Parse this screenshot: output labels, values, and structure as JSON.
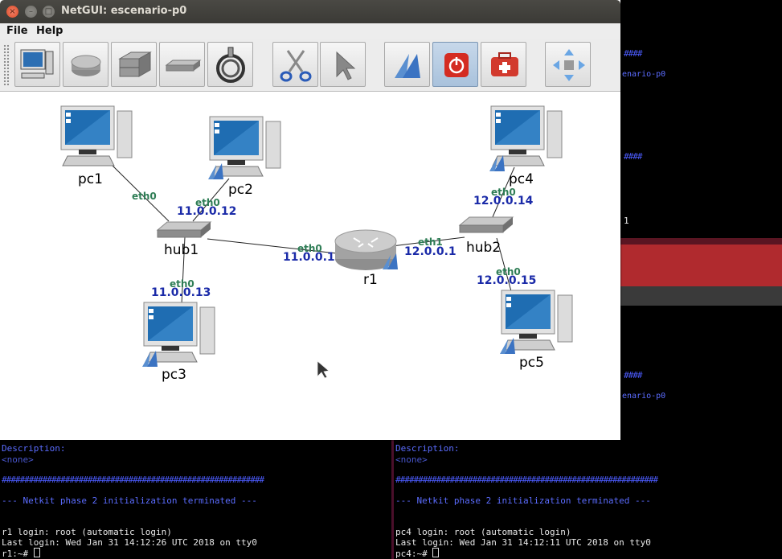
{
  "window": {
    "title": "NetGUI: escenario-p0",
    "controls": {
      "close": "×",
      "minimize": "–",
      "maximize": "□"
    }
  },
  "menubar": {
    "items": [
      {
        "label": "File"
      },
      {
        "label": "Help"
      }
    ]
  },
  "toolbar": {
    "tools": [
      {
        "name": "add-terminal-tool",
        "icon": "pc-icon"
      },
      {
        "name": "add-router-tool",
        "icon": "router-icon"
      },
      {
        "name": "add-switch-tool",
        "icon": "switch-icon"
      },
      {
        "name": "add-hub-tool",
        "icon": "hub-icon"
      },
      {
        "name": "add-link-tool",
        "icon": "cable-icon"
      },
      {
        "name": "delete-tool",
        "icon": "scissors-icon"
      },
      {
        "name": "select-tool",
        "icon": "pointer-icon"
      },
      {
        "name": "start-tool",
        "icon": "start-icon"
      },
      {
        "name": "power-tool",
        "icon": "power-icon",
        "active": true
      },
      {
        "name": "toolbox-tool",
        "icon": "toolbox-icon"
      },
      {
        "name": "move-tool",
        "icon": "move-arrows-icon"
      }
    ]
  },
  "network": {
    "nodes": [
      {
        "id": "pc1",
        "label": "pc1",
        "type": "pc"
      },
      {
        "id": "pc2",
        "label": "pc2",
        "type": "pc"
      },
      {
        "id": "pc3",
        "label": "pc3",
        "type": "pc"
      },
      {
        "id": "pc4",
        "label": "pc4",
        "type": "pc"
      },
      {
        "id": "pc5",
        "label": "pc5",
        "type": "pc"
      },
      {
        "id": "hub1",
        "label": "hub1",
        "type": "hub"
      },
      {
        "id": "hub2",
        "label": "hub2",
        "type": "hub"
      },
      {
        "id": "r1",
        "label": "r1",
        "type": "router"
      }
    ],
    "interfaces": [
      {
        "node": "pc1",
        "name": "eth0",
        "ip": ""
      },
      {
        "node": "pc2",
        "name": "eth0",
        "ip": "11.0.0.12"
      },
      {
        "node": "pc3",
        "name": "eth0",
        "ip": "11.0.0.13"
      },
      {
        "node": "r1",
        "name": "eth0",
        "ip": "11.0.0.1"
      },
      {
        "node": "r1",
        "name": "eth1",
        "ip": "12.0.0.1"
      },
      {
        "node": "pc4",
        "name": "eth0",
        "ip": "12.0.0.14"
      },
      {
        "node": "pc5",
        "name": "eth0",
        "ip": "12.0.0.15"
      }
    ]
  },
  "terminal_left": {
    "description_label": "Description:",
    "description_value": "<none>",
    "hash_bar": "##########################################################",
    "phase_msg": "--- Netkit phase 2 initialization terminated ---",
    "login_line": "r1 login: root (automatic login)",
    "last_login": "Last login: Wed Jan 31 14:12:26 UTC 2018 on tty0",
    "prompt": "r1:~# "
  },
  "terminal_right": {
    "description_label": "Description:",
    "description_value": "<none>",
    "hash_bar": "##########################################################",
    "phase_msg": "--- Netkit phase 2 initialization terminated ---",
    "login_line": "pc4 login: root (automatic login)",
    "last_login": "Last login: Wed Jan 31 14:12:11 UTC 2018 on tty0",
    "prompt": "pc4:~# ",
    "fragments": {
      "hash_short": "####",
      "scenario_frag": "enario-p0",
      "one": "1"
    }
  },
  "colors": {
    "ifname": "#2e7d55",
    "ip": "#1a2aa8",
    "titlebar": "#3c3b37",
    "active_tool": "#a9c2dc"
  }
}
